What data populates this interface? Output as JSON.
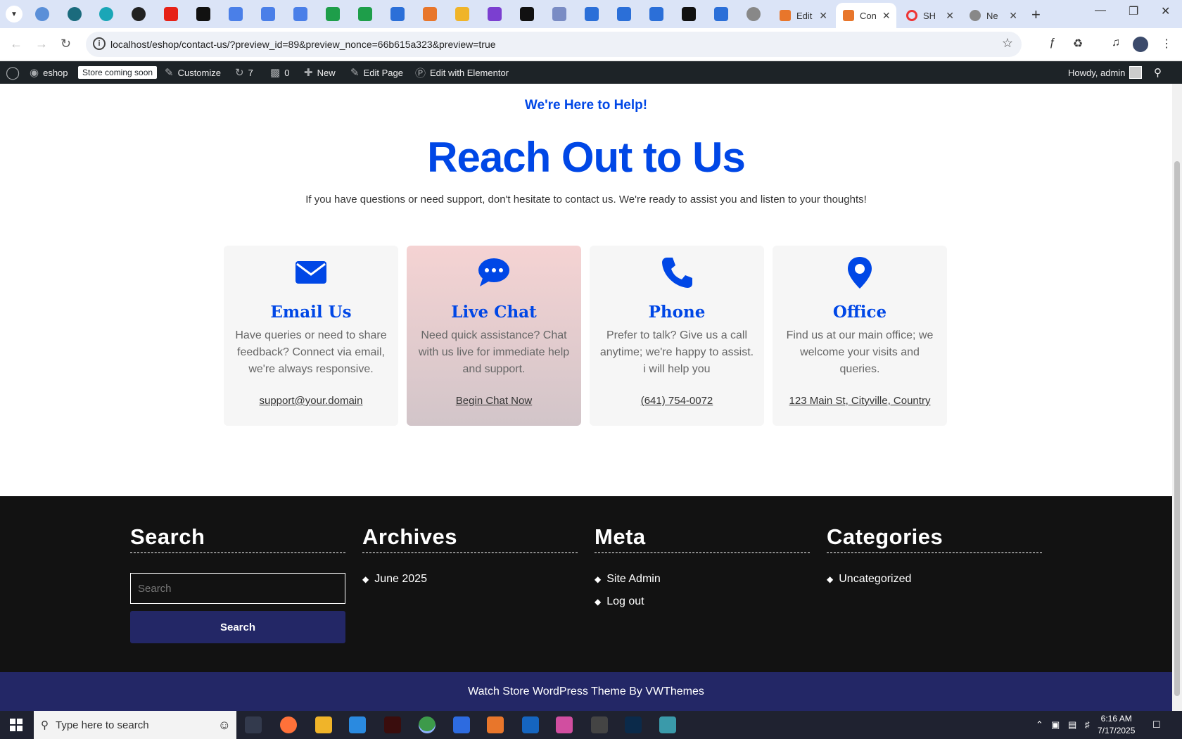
{
  "browser": {
    "tabs": [
      {
        "title": "Edit"
      },
      {
        "title": "Con",
        "active": true
      },
      {
        "title": "SH"
      },
      {
        "title": "Ne"
      }
    ],
    "url": "localhost/eshop/contact-us/?preview_id=89&preview_nonce=66b615a323&preview=true"
  },
  "adminbar": {
    "site_name": "eshop",
    "store_badge": "Store coming soon",
    "customize": "Customize",
    "updates_count": "7",
    "comments_count": "0",
    "new_label": "New",
    "edit_page": "Edit Page",
    "edit_elementor": "Edit with Elementor",
    "howdy": "Howdy, admin"
  },
  "hero": {
    "eyebrow": "We're Here to Help!",
    "headline": "Reach Out to Us",
    "intro": "If you have questions or need support, don't hesitate to contact us. We're ready to assist you and listen to your thoughts!"
  },
  "cards": [
    {
      "icon": "envelope-icon",
      "title": "Email Us",
      "text": "Have queries or need to share feedback? Connect via email, we're always responsive.",
      "link": "support@your.domain"
    },
    {
      "icon": "chat-bubble-icon",
      "title": "Live Chat",
      "text": "Need quick assistance? Chat with us live for immediate help and support.",
      "link": "Begin Chat Now"
    },
    {
      "icon": "phone-icon",
      "title": "Phone",
      "text": "Prefer to talk? Give us a call anytime; we're happy to assist. i will help you",
      "link": "(641) 754-0072"
    },
    {
      "icon": "map-pin-icon",
      "title": "Office",
      "text": "Find us at our main office; we welcome your visits and queries.",
      "link": "123 Main St, Cityville, Country"
    }
  ],
  "footer": {
    "search": {
      "title": "Search",
      "placeholder": "Search",
      "button": "Search"
    },
    "archives": {
      "title": "Archives",
      "items": [
        "June 2025"
      ]
    },
    "meta": {
      "title": "Meta",
      "items": [
        "Site Admin",
        "Log out"
      ]
    },
    "categories": {
      "title": "Categories",
      "items": [
        "Uncategorized"
      ]
    },
    "copyright": "Watch Store WordPress Theme By VWThemes"
  },
  "taskbar": {
    "search_placeholder": "Type here to search",
    "time": "6:16 AM",
    "date": "7/17/2025"
  },
  "colors": {
    "accent": "#0047e6",
    "footer_bg": "#121212",
    "button_bg": "#232766",
    "adminbar_bg": "#1d2327"
  }
}
